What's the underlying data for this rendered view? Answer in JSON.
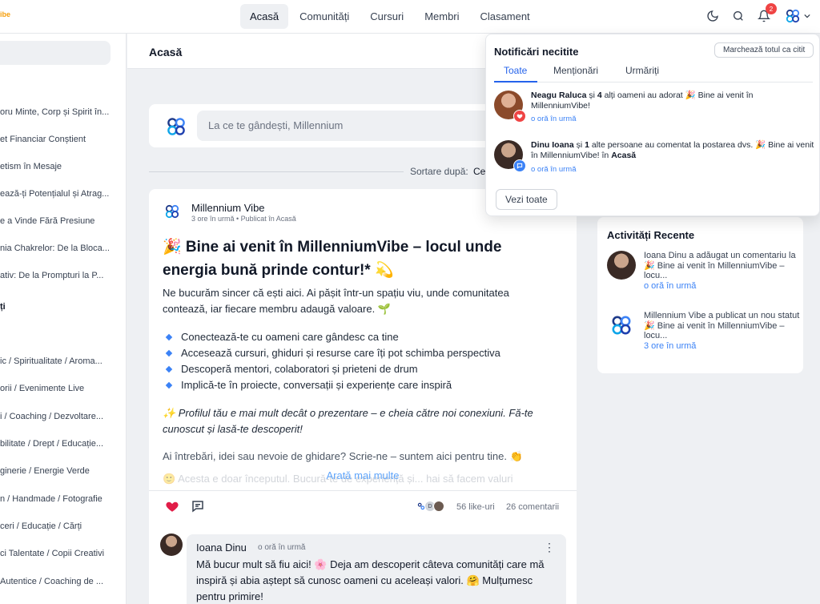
{
  "brand": {
    "logo_fragment": "ibe"
  },
  "nav": {
    "items": [
      {
        "label": "Acasă",
        "active": true
      },
      {
        "label": "Comunități",
        "active": false
      },
      {
        "label": "Cursuri",
        "active": false
      },
      {
        "label": "Membri",
        "active": false
      },
      {
        "label": "Clasament",
        "active": false
      }
    ]
  },
  "top_icons": {
    "notifications_badge": "2"
  },
  "sidebar": {
    "items": [
      "oru Minte, Corp și Spirit în...",
      "et Financiar Conștient",
      "etism în Mesaje",
      "ează-ți Potențialul și Atrag...",
      "e a Vinde Fără Presiune",
      "nia Chakrelor: De la Bloca...",
      "ativ: De la Prompturi la P..."
    ],
    "section_heading": "ți",
    "categories": [
      "ic / Spiritualitate / Aroma...",
      "orii / Evenimente Live",
      "i / Coaching / Dezvoltare...",
      "bilitate / Drept / Educație...",
      "ginerie / Energie Verde",
      "n / Handmade / Fotografie",
      "ceri / Educație / Cărți",
      "ci Talentate / Copii Creativi",
      "Autentice / Coaching de ..."
    ]
  },
  "main": {
    "title": "Acasă",
    "composer_placeholder": "La ce te gândești, Millennium",
    "sort_label": "Sortare după:",
    "sort_value": "Ce"
  },
  "post": {
    "author": "Millennium Vibe",
    "meta": "3 ore în urmă • Publicat în Acasă",
    "title": "🎉 Bine ai venit în MillenniumVibe – locul unde energia bună prinde contur!* 💫",
    "intro": "Ne bucurăm sincer că ești aici. Ai pășit într-un spațiu viu, unde comunitatea contează, iar fiecare membru adaugă valoare. 🌱",
    "bullets": [
      "Conectează-te cu oameni care gândesc ca tine",
      "Accesează cursuri, ghiduri și resurse care îți pot schimba perspectiva",
      "Descoperă mentori, colaboratori și prieteni de drum",
      "Implică-te în proiecte, conversații și experiențe care inspiră"
    ],
    "profile_note": "✨ Profilul tău e mai mult decât o prezentare – e cheia către noi conexiuni. Fă-te cunoscut și lasă-te descoperit!",
    "questions": "Ai întrebări, idei sau nevoie de ghidare? Scrie-ne – suntem aici pentru tine. 👏",
    "faded": "🙂 Acesta e doar începutul. Bucură-te de experiență și... hai să facem valuri",
    "show_more": "Arată mai multe",
    "likes": "56 like-uri",
    "comments": "26 comentarii",
    "liker_initial": "D"
  },
  "comment": {
    "author": "Ioana Dinu",
    "time": "o oră în urmă",
    "text": "Mă bucur mult să fiu aici! 🌸 Deja am descoperit câteva comunități care mă inspiră și abia aștept să cunosc oameni cu aceleași valori. 🤗 Mulțumesc pentru primire!"
  },
  "activity": {
    "title": "Activități Recente",
    "items": [
      {
        "text": "Ioana Dinu a adăugat un comentariu la 🎉 Bine ai venit în MillenniumVibe – locu...",
        "time": "o oră în urmă"
      },
      {
        "text": "Millennium Vibe a publicat un nou statut 🎉 Bine ai venit în MillenniumVibe – locu...",
        "time": "3 ore în urmă"
      }
    ]
  },
  "notifications": {
    "title": "Notificări necitite",
    "mark_all": "Marchează totul ca citit",
    "tabs": [
      "Toate",
      "Menționări",
      "Urmăriți"
    ],
    "items": [
      {
        "name": "Neagu Raluca",
        "mid": " și ",
        "count": "4",
        "rest": " alți oameni au adorat 🎉 Bine ai venit în MillenniumVibe!",
        "time": "o oră în urmă"
      },
      {
        "name": "Dinu Ioana",
        "mid": " și ",
        "count": "1",
        "rest": " alte persoane au comentat la postarea dvs. 🎉 Bine ai venit în MillenniumVibe! în ",
        "place": "Acasă",
        "time": "o oră în urmă"
      }
    ],
    "view_all": "Vezi toate"
  },
  "colors": {
    "accent": "#2563eb",
    "like_red": "#e11d48",
    "logo_blue": "#1e3a8a"
  }
}
